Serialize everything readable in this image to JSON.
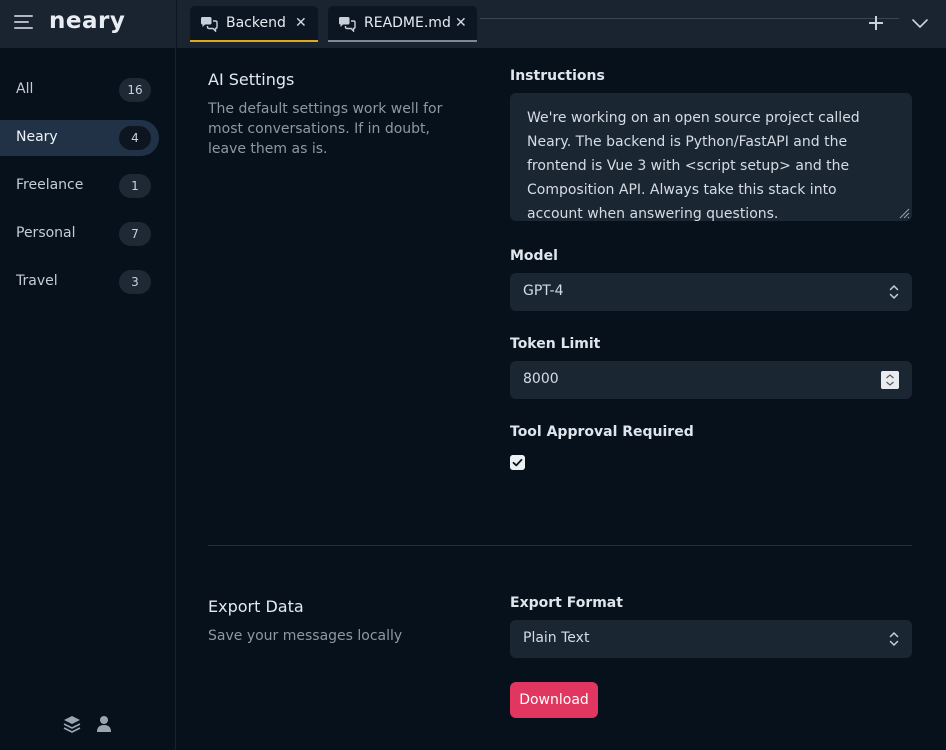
{
  "app": {
    "logo": "neary"
  },
  "tabs": [
    {
      "label": "Backend",
      "close": "✕"
    },
    {
      "label": "README.md",
      "close": "✕"
    }
  ],
  "sidebar": {
    "items": [
      {
        "label": "All",
        "count": "16"
      },
      {
        "label": "Neary",
        "count": "4"
      },
      {
        "label": "Freelance",
        "count": "1"
      },
      {
        "label": "Personal",
        "count": "7"
      },
      {
        "label": "Travel",
        "count": "3"
      }
    ],
    "active_index": 1
  },
  "ai_settings": {
    "title": "AI Settings",
    "description": "The default settings work well for most conversations. If in doubt, leave them as is.",
    "instructions_label": "Instructions",
    "instructions_value": "We're working on an open source project called Neary. The backend is Python/FastAPI and the frontend is Vue 3 with <script setup> and the Composition API. Always take this stack into account when answering questions.",
    "model_label": "Model",
    "model_value": "GPT-4",
    "token_limit_label": "Token Limit",
    "token_limit_value": "8000",
    "tool_approval_label": "Tool Approval Required",
    "tool_approval_checked": true
  },
  "export": {
    "title": "Export Data",
    "description": "Save your messages locally",
    "format_label": "Export Format",
    "format_value": "Plain Text",
    "download_label": "Download"
  },
  "colors": {
    "accent": "#e0365f",
    "active_tab_underline": "#e0a91a",
    "background": "#07111c",
    "topbar": "#1a2330",
    "input_bg": "#1b2633"
  },
  "icons": {
    "menu": "menu-icon",
    "tab": "chat-bubbles-icon",
    "close": "close-icon",
    "add": "plus-icon",
    "dropdown": "chevron-down-icon",
    "layers": "layers-icon",
    "user": "user-icon"
  }
}
